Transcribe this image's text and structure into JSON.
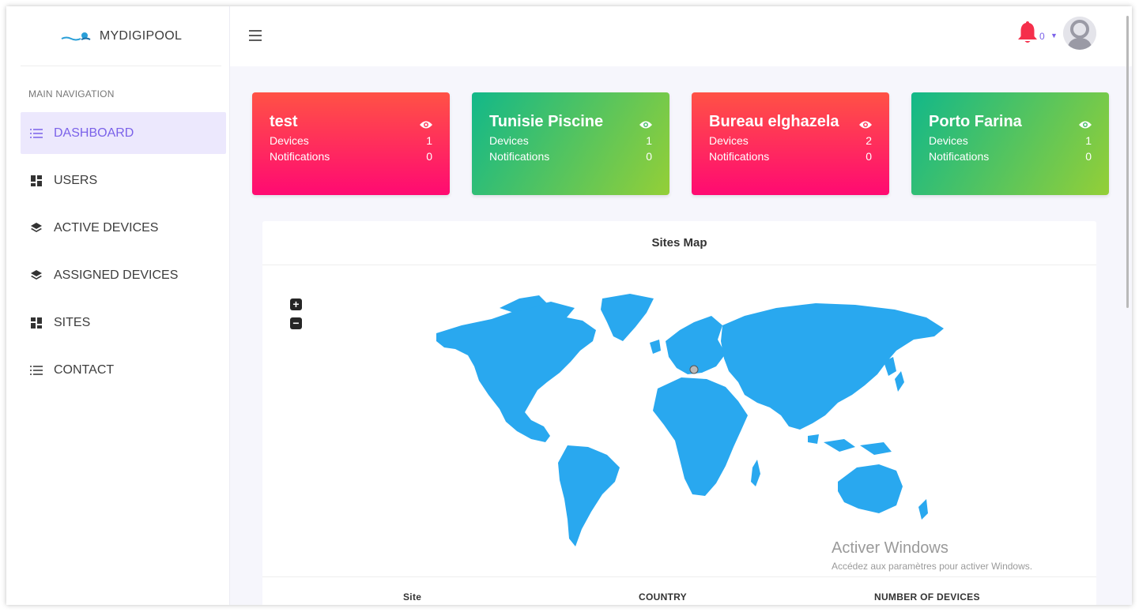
{
  "brand": {
    "name": "MYDIGIPOOL",
    "logo_icon": "wave-logo-icon"
  },
  "sidebar": {
    "header": "MAIN NAVIGATION",
    "items": [
      {
        "label": "DASHBOARD",
        "icon": "list-icon",
        "active": true
      },
      {
        "label": "USERS",
        "icon": "grid-icon"
      },
      {
        "label": "ACTIVE DEVICES",
        "icon": "layers-icon"
      },
      {
        "label": "ASSIGNED DEVICES",
        "icon": "layers-icon"
      },
      {
        "label": "SITES",
        "icon": "grid-icon"
      },
      {
        "label": "CONTACT",
        "icon": "list-icon"
      }
    ]
  },
  "topbar": {
    "menu_icon": "hamburger-icon",
    "notification_count": "0",
    "notification_icon": "bell-icon"
  },
  "cards": [
    {
      "title": "test",
      "devices_label": "Devices",
      "devices": "1",
      "notifications_label": "Notifications",
      "notifications": "0",
      "color": "red"
    },
    {
      "title": "Tunisie Piscine",
      "devices_label": "Devices",
      "devices": "1",
      "notifications_label": "Notifications",
      "notifications": "0",
      "color": "green"
    },
    {
      "title": "Bureau elghazela",
      "devices_label": "Devices",
      "devices": "2",
      "notifications_label": "Notifications",
      "notifications": "0",
      "color": "red"
    },
    {
      "title": "Porto Farina",
      "devices_label": "Devices",
      "devices": "1",
      "notifications_label": "Notifications",
      "notifications": "0",
      "color": "green"
    }
  ],
  "map_panel": {
    "title": "Sites Map",
    "zoom_in": "+",
    "zoom_out": "−",
    "columns": [
      "Site",
      "COUNTRY",
      "NUMBER OF DEVICES"
    ]
  },
  "watermark": {
    "title": "Activer Windows",
    "subtitle": "Accédez aux paramètres pour activer Windows."
  },
  "colors": {
    "accent": "#7b62e9",
    "map_land": "#29a8ef",
    "card_red": "#ff2a5f",
    "card_green": "#3cbf6f",
    "bell": "#f52f4b"
  }
}
